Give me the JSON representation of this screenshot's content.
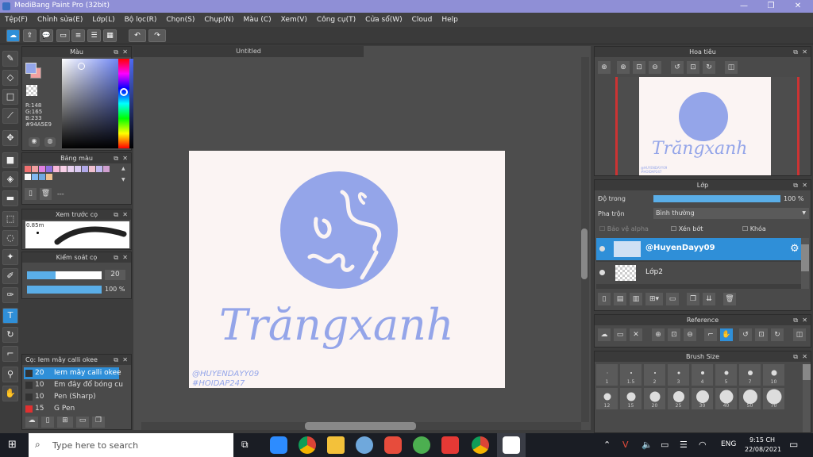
{
  "window": {
    "title": "MediBang Paint Pro (32bit)",
    "minimize": "—",
    "maximize": "❐",
    "close": "✕"
  },
  "menu": [
    "Tệp(F)",
    "Chỉnh sửa(E)",
    "Lớp(L)",
    "Bộ lọc(R)",
    "Chọn(S)",
    "Chụp(N)",
    "Màu (C)",
    "Xem(V)",
    "Công cụ(T)",
    "Cửa sổ(W)",
    "Cloud",
    "Help"
  ],
  "doc_tab": "Untitled",
  "color_panel": {
    "title": "Màu",
    "r": "R:148",
    "g": "G:165",
    "b": "B:233",
    "hex": "#94A5E9",
    "fg_color": "#94a5e9",
    "bg_color": "#f2a0a0"
  },
  "palette_panel": {
    "title": "Bảng màu",
    "label": "---"
  },
  "brush_preview_panel": {
    "title": "Xem trước cọ",
    "size": "0.85m"
  },
  "brush_control_panel": {
    "title": "Kiểm soát cọ",
    "size_value": "20",
    "opacity_value": "100 %"
  },
  "brush_list_panel": {
    "title": "Cọ: Iem mây calli okee",
    "items": [
      {
        "size": "20",
        "name": "Iem mây calli okee",
        "selected": true,
        "color": "#333333"
      },
      {
        "size": "10",
        "name": "Em đây đổ bóng cu",
        "selected": false,
        "color": "#333333"
      },
      {
        "size": "10",
        "name": "Pen (Sharp)",
        "selected": false,
        "color": "#333333"
      },
      {
        "size": "15",
        "name": "G Pen",
        "selected": false,
        "color": "#e03030"
      }
    ]
  },
  "artwork": {
    "title": "Trăngxanh",
    "watermark1": "@HUYENDAYY09",
    "watermark2": "#HOIDAP247",
    "color": "#94a5e9"
  },
  "navigator_panel": {
    "title": "Hoa tiêu",
    "preview_text": "Trăngxanh",
    "wm1": "@HUYENDAYY09",
    "wm2": "#HOIDAP247"
  },
  "layer_panel": {
    "title": "Lớp",
    "opacity_label": "Độ trong",
    "opacity_value": "100 %",
    "opacity_fraction": 1.0,
    "blend_label": "Pha trộn",
    "blend_value": "Bình thường",
    "protect_alpha": "Bảo vệ alpha",
    "clipping": "Xén bớt",
    "lock": "Khóa",
    "layers": [
      {
        "name": "@HuyenDayy09",
        "selected": true
      },
      {
        "name": "Lớp2",
        "selected": false
      }
    ]
  },
  "reference_panel": {
    "title": "Reference"
  },
  "brush_size_panel": {
    "title": "Brush Size",
    "row1": [
      "1",
      "1.5",
      "2",
      "3",
      "4",
      "5",
      "7",
      "10"
    ],
    "row2": [
      "12",
      "15",
      "20",
      "25",
      "30",
      "40",
      "50",
      "70"
    ]
  },
  "taskbar": {
    "search_placeholder": "Type here to search",
    "lang": "ENG",
    "time": "9:15 CH",
    "date": "22/08/2021"
  }
}
